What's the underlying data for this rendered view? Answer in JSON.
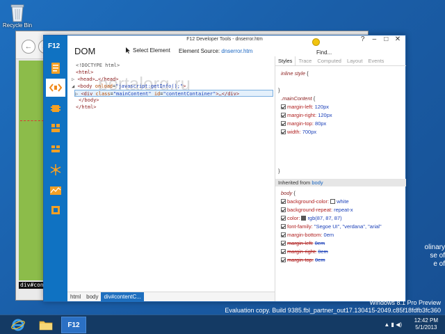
{
  "desktop": {
    "recycle_bin_label": "Recycle Bin",
    "partial_text": [
      "olinary",
      "se of",
      "e of"
    ],
    "watermark_text": "Evaluation copy. Build 9385.fbl_partner_out17.130415-2049.c85f18fdfb3fc360",
    "edition_text": "Windows 8.1 Pro Preview"
  },
  "background_window": {
    "back_label": "←",
    "forward_label": "→",
    "status_text": "div#contentC"
  },
  "devtools": {
    "title": "F12 Developer Tools - dnserror.htm",
    "window_controls": {
      "help": "?",
      "minimize": "–",
      "maximize": "□",
      "close": "✕"
    },
    "logo": "F12",
    "pane_title": "DOM",
    "select_element_label": "Select Element",
    "element_source_label": "Element Source:",
    "element_source_file": "dnserror.htm",
    "find_label": "Find...",
    "watermark": "portalorg.ru",
    "dom_tree": {
      "doctype": "<!DOCTYPE html>",
      "html_open": "<html>",
      "head": "<head>…</head>",
      "body_tag": "<body",
      "body_attr": "onload",
      "body_val": "\"javascript:getInfo();\"",
      "body_close": ">",
      "div_open": "<div",
      "div_attr_class": "class",
      "div_val_class": "\"mainContent\"",
      "div_attr_id": "id",
      "div_val_id": "\"contentContainer\"",
      "div_rest": ">…</div>",
      "body_end": "</body>",
      "html_end": "</html>"
    },
    "breadcrumbs": [
      "html",
      "body",
      "div#contentC..."
    ],
    "style_tabs": [
      "Styles",
      "Trace",
      "Computed",
      "Layout",
      "Events"
    ],
    "styles": {
      "inline_selector": "inline style",
      "main_selector": ".mainContent",
      "main_rules": [
        {
          "name": "margin-left:",
          "value": "120px"
        },
        {
          "name": "margin-right:",
          "value": "120px"
        },
        {
          "name": "margin-top:",
          "value": "80px"
        },
        {
          "name": "width:",
          "value": "700px"
        }
      ],
      "inherited_label": "Inherited from",
      "inherited_from": "body",
      "body_selector": "body",
      "body_rules": [
        {
          "name": "background-color:",
          "value": "white",
          "swatch": "#ffffff",
          "struck": false
        },
        {
          "name": "background-repeat:",
          "value": "repeat-x",
          "struck": false
        },
        {
          "name": "color:",
          "value": "rgb(87, 87, 87)",
          "swatch": "#575757",
          "struck": false
        },
        {
          "name": "font-family:",
          "value": "\"Segoe UI\", \"verdana\", \"arial\"",
          "struck": false
        },
        {
          "name": "margin-bottom:",
          "value": "0em",
          "struck": false
        },
        {
          "name": "margin-left:",
          "value": "0em",
          "struck": true
        },
        {
          "name": "margin-right:",
          "value": "0em",
          "struck": true
        },
        {
          "name": "margin-top:",
          "value": "0em",
          "struck": true
        }
      ]
    },
    "sidebar_tools": [
      "dom-explorer-icon",
      "console-icon",
      "debugger-icon",
      "network-icon",
      "ui-responsiveness-icon",
      "profiler-icon",
      "memory-icon",
      "emulation-icon"
    ]
  },
  "taskbar": {
    "apps": [
      "internet-explorer",
      "file-explorer",
      "f12-tools"
    ],
    "f12_label": "F12",
    "time": "12:42 PM",
    "date": "5/1/2013"
  },
  "colors": {
    "accent": "#0f72c2",
    "desktop": "#1e6fbf",
    "taskbar": "#143a64",
    "tag": "#8a1c1c",
    "attribute_value": "#1a3fb8"
  }
}
